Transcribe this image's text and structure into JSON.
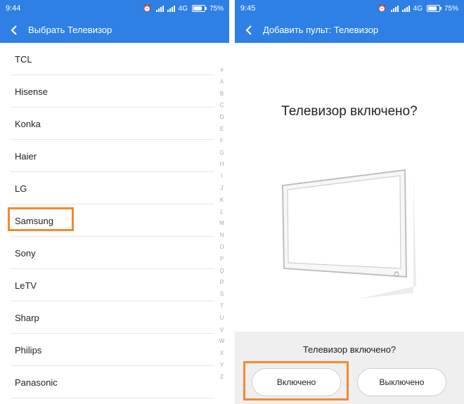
{
  "left_panel": {
    "status": {
      "time": "9:44",
      "network": "4G",
      "battery": "75%"
    },
    "title": "Выбрать Телевизор",
    "brands": [
      "TCL",
      "Hisense",
      "Konka",
      "Haier",
      "LG",
      "Samsung",
      "Sony",
      "LeTV",
      "Sharp",
      "Philips",
      "Panasonic"
    ],
    "index_letters": [
      "#",
      "A",
      "B",
      "C",
      "D",
      "E",
      "F",
      "G",
      "H",
      "I",
      "J",
      "K",
      "L",
      "M",
      "N",
      "O",
      "P",
      "Q",
      "R",
      "S",
      "T",
      "U",
      "V",
      "W",
      "X",
      "Y",
      "Z"
    ],
    "highlighted_brand": "Samsung"
  },
  "right_panel": {
    "status": {
      "time": "9:45",
      "network": "4G",
      "battery": "75%"
    },
    "title": "Добавить пульт: Телевизор",
    "question_big": "Телевизор включено?",
    "question_small": "Телевизор включено?",
    "button_on": "Включено",
    "button_off": "Выключено"
  },
  "colors": {
    "accent": "#2f80e4",
    "highlight": "#f28a2e"
  }
}
